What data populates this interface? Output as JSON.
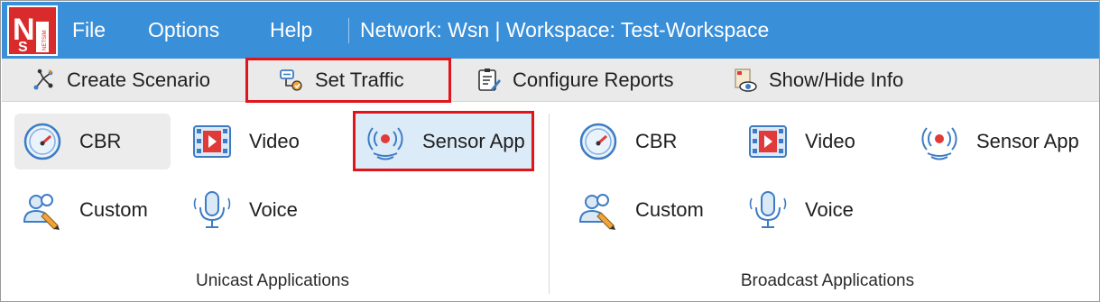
{
  "app": {
    "logo_letters": "NS",
    "logo_text": "NETSIM"
  },
  "menu": {
    "file": "File",
    "options": "Options",
    "help": "Help"
  },
  "title": "Network: Wsn | Workspace: Test-Workspace",
  "toolbar": {
    "create_scenario": "Create Scenario",
    "set_traffic": "Set Traffic",
    "configure_reports": "Configure Reports",
    "show_hide_info": "Show/Hide Info"
  },
  "unicast": {
    "label": "Unicast Applications",
    "cbr": "CBR",
    "video": "Video",
    "sensor_app": "Sensor App",
    "custom": "Custom",
    "voice": "Voice"
  },
  "broadcast": {
    "label": "Broadcast Applications",
    "cbr": "CBR",
    "video": "Video",
    "sensor_app": "Sensor App",
    "custom": "Custom",
    "voice": "Voice"
  },
  "colors": {
    "menubar": "#3a8fd9",
    "highlight_border": "#e0151c",
    "logo_red": "#d92b2b",
    "icon_blue": "#3d7cc4",
    "icon_red": "#e03a3a"
  }
}
